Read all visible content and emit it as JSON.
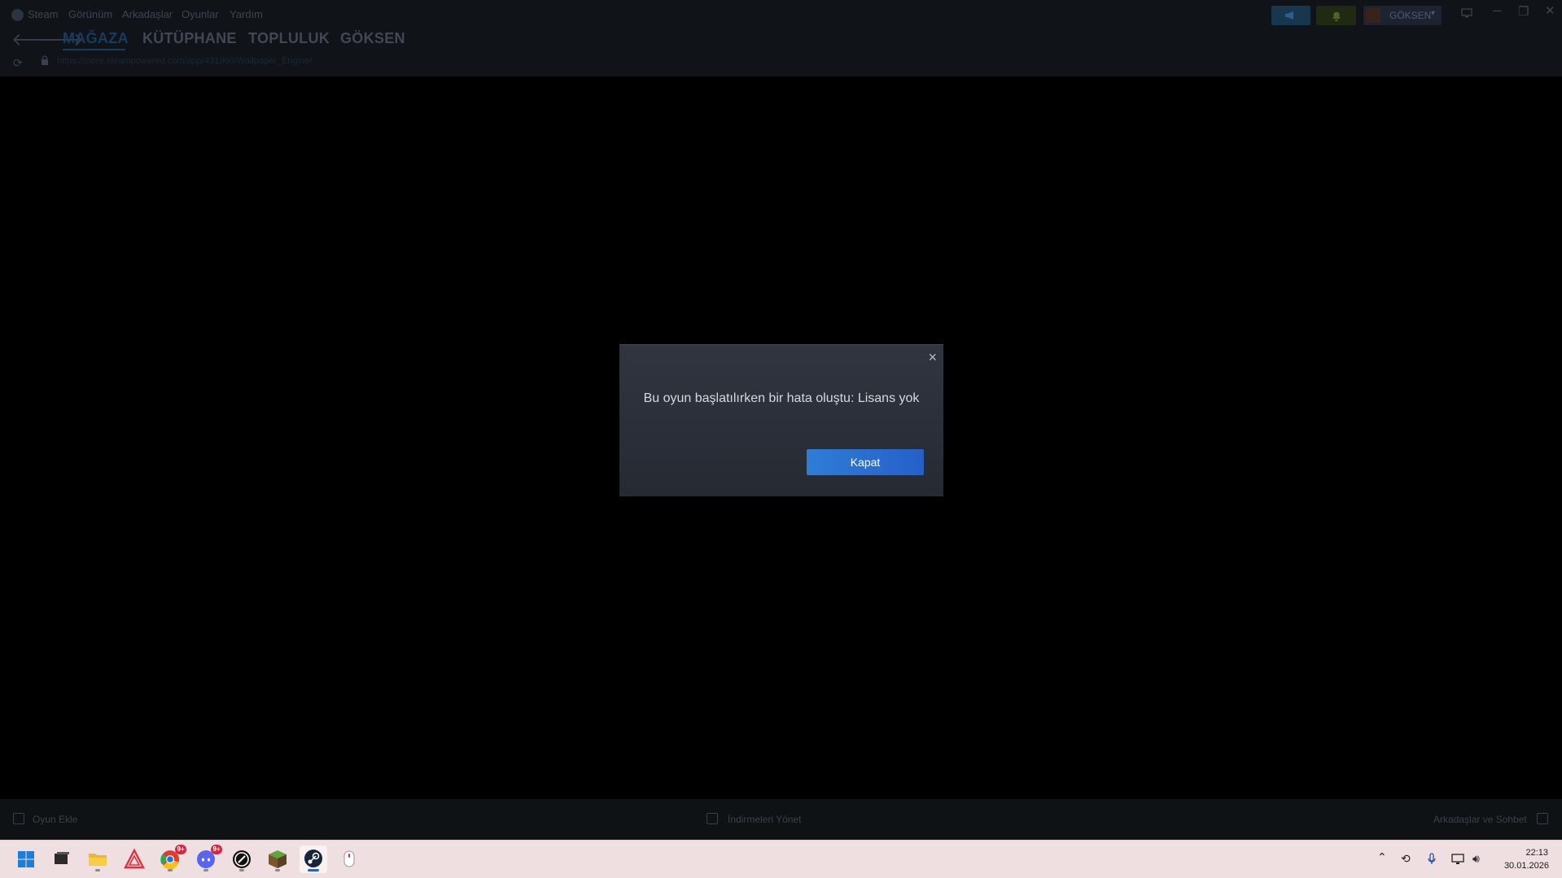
{
  "menu": {
    "items": [
      "Steam",
      "Görünüm",
      "Arkadaşlar",
      "Oyunlar",
      "Yardım"
    ]
  },
  "user": {
    "name": "GÖKSEN"
  },
  "nav": {
    "tabs": [
      "MAĞAZA",
      "KÜTÜPHANE",
      "TOPLULUK",
      "GÖKSEN"
    ],
    "active_tab": "MAĞAZA",
    "url": "https://store.steampowered.com/app/431960/Wallpaper_Engine/"
  },
  "bottom_bar": {
    "add_game": "Oyun Ekle",
    "downloads": "İndirmeleri Yönet",
    "friends_chat": "Arkadaşlar ve Sohbet"
  },
  "dialog": {
    "message": "Bu oyun başlatılırken bir hata oluştu: Lisans yok",
    "button_label": "Kapat",
    "close_icon": "close-icon"
  },
  "taskbar": {
    "apps": [
      {
        "name": "windows-start-icon"
      },
      {
        "name": "task-view-icon"
      },
      {
        "name": "file-explorer-icon"
      },
      {
        "name": "affinity-icon"
      },
      {
        "name": "chrome-icon",
        "badge": "9+"
      },
      {
        "name": "discord-icon",
        "badge": "9+"
      },
      {
        "name": "obs-icon"
      },
      {
        "name": "minecraft-icon"
      },
      {
        "name": "steam-icon",
        "active": true
      },
      {
        "name": "mouse-app-icon"
      }
    ],
    "clock": {
      "time": "22:13",
      "date": "30.01.2026"
    }
  },
  "colors": {
    "accent": "#2f7dd6",
    "taskbar": "#efdfe1"
  }
}
